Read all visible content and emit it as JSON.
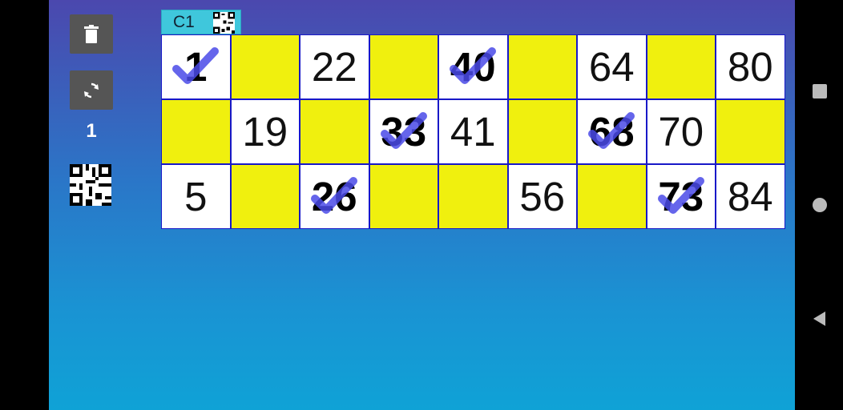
{
  "toolbar": {
    "count": "1"
  },
  "card": {
    "tab_label": "C1"
  },
  "grid": {
    "rows": [
      [
        {
          "value": "1",
          "marked": true
        },
        {
          "value": "",
          "marked": false
        },
        {
          "value": "22",
          "marked": false
        },
        {
          "value": "",
          "marked": false
        },
        {
          "value": "40",
          "marked": true
        },
        {
          "value": "",
          "marked": false
        },
        {
          "value": "64",
          "marked": false
        },
        {
          "value": "",
          "marked": false
        },
        {
          "value": "80",
          "marked": false
        }
      ],
      [
        {
          "value": "",
          "marked": false
        },
        {
          "value": "19",
          "marked": false
        },
        {
          "value": "",
          "marked": false
        },
        {
          "value": "33",
          "marked": true
        },
        {
          "value": "41",
          "marked": false
        },
        {
          "value": "",
          "marked": false
        },
        {
          "value": "68",
          "marked": true
        },
        {
          "value": "70",
          "marked": false
        },
        {
          "value": "",
          "marked": false
        }
      ],
      [
        {
          "value": "5",
          "marked": false
        },
        {
          "value": "",
          "marked": false
        },
        {
          "value": "26",
          "marked": true
        },
        {
          "value": "",
          "marked": false
        },
        {
          "value": "",
          "marked": false
        },
        {
          "value": "56",
          "marked": false
        },
        {
          "value": "",
          "marked": false
        },
        {
          "value": "73",
          "marked": true
        },
        {
          "value": "84",
          "marked": false
        }
      ]
    ]
  },
  "colors": {
    "blank_cell": "#f0f00e",
    "number_cell": "#ffffff",
    "grid_border": "#1818c8",
    "check_mark": "#4a4ae8",
    "tab_background": "#3fc7dc"
  },
  "icons": {
    "trash": "trash-icon",
    "refresh": "refresh-icon",
    "qr": "qr-code-icon",
    "check": "check-icon",
    "nav_recents": "square-icon",
    "nav_home": "circle-icon",
    "nav_back": "triangle-back-icon"
  }
}
